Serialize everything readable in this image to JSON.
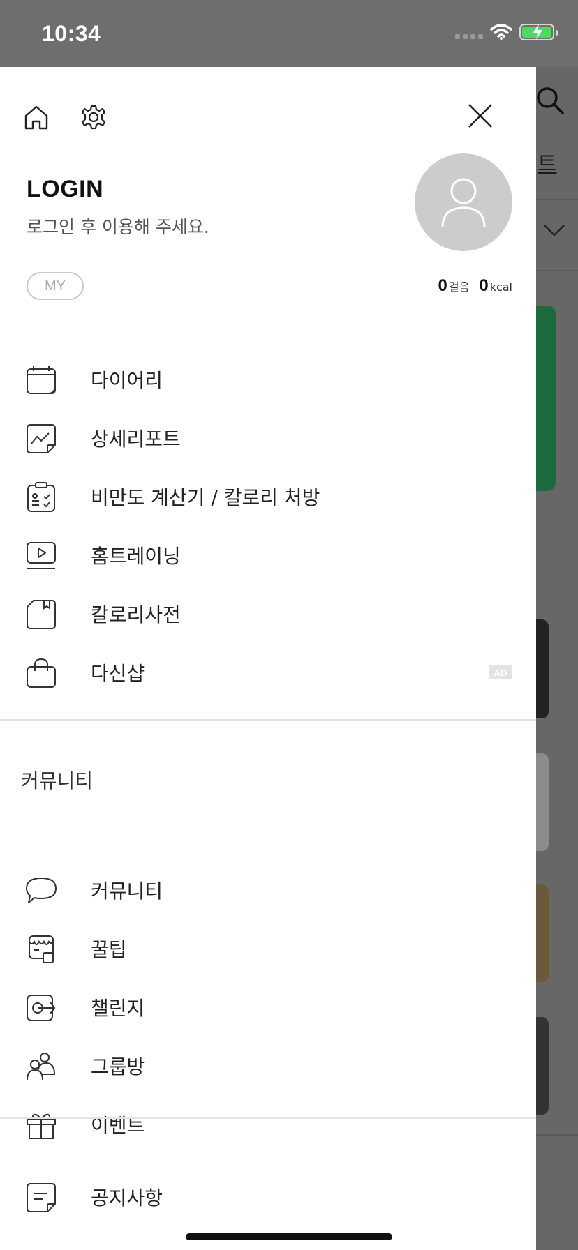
{
  "status_bar": {
    "time": "10:34"
  },
  "background": {
    "tab_fragment": "트"
  },
  "drawer": {
    "login": {
      "title": "LOGIN",
      "subtitle": "로그인 후 이용해 주세요."
    },
    "my_button": "MY",
    "stats": {
      "steps_value": "0",
      "steps_unit": "걸음",
      "kcal_value": "0",
      "kcal_unit": "kcal"
    },
    "main_menu": [
      {
        "label": "다이어리",
        "icon": "calendar-icon"
      },
      {
        "label": "상세리포트",
        "icon": "chart-report-icon"
      },
      {
        "label": "비만도 계산기 / 칼로리 처방",
        "icon": "clipboard-checklist-icon"
      },
      {
        "label": "홈트레이닝",
        "icon": "video-play-icon"
      },
      {
        "label": "칼로리사전",
        "icon": "bookmark-book-icon"
      },
      {
        "label": "다신샵",
        "icon": "shopping-bag-icon",
        "badge": "AD"
      }
    ],
    "community_section_title": "커뮤니티",
    "community_menu": [
      {
        "label": "커뮤니티",
        "icon": "speech-bubble-icon"
      },
      {
        "label": "꿀팁",
        "icon": "honey-pot-icon"
      },
      {
        "label": "챌린지",
        "icon": "target-arrow-icon"
      },
      {
        "label": "그룹방",
        "icon": "group-people-icon"
      },
      {
        "label": "이벤트",
        "icon": "gift-icon"
      }
    ],
    "notice_menu": [
      {
        "label": "공지사항",
        "icon": "notice-note-icon"
      }
    ]
  }
}
